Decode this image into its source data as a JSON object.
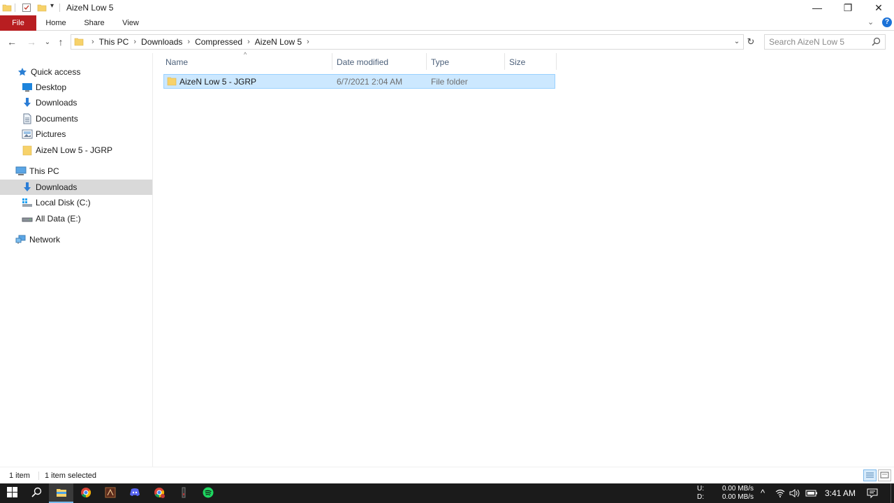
{
  "window": {
    "title": "AizeN Low 5",
    "controls": {
      "minimize": "—",
      "restore": "❐",
      "close": "✕"
    }
  },
  "ribbon": {
    "tabs": [
      "File",
      "Home",
      "Share",
      "View"
    ],
    "expand_glyph": "⌄",
    "help_glyph": "?"
  },
  "nav": {
    "back": "←",
    "forward": "→",
    "recent": "⌄",
    "up": "↑",
    "breadcrumbs": [
      "This PC",
      "Downloads",
      "Compressed",
      "AizeN Low 5"
    ],
    "separator": "›",
    "dropdown": "⌄",
    "refresh": "↻",
    "search_placeholder": "Search AizeN Low 5"
  },
  "sidebar": {
    "quick_access_label": "Quick access",
    "quick_items": [
      {
        "label": "Desktop",
        "icon": "desktop-icon",
        "pinned": true
      },
      {
        "label": "Downloads",
        "icon": "download-icon",
        "pinned": true
      },
      {
        "label": "Documents",
        "icon": "document-icon",
        "pinned": true
      },
      {
        "label": "Pictures",
        "icon": "pictures-icon",
        "pinned": true
      },
      {
        "label": "AizeN Low 5 - JGRP",
        "icon": "folder-icon",
        "pinned": true
      }
    ],
    "this_pc_label": "This PC",
    "pc_items": [
      {
        "label": "Downloads",
        "icon": "download-icon",
        "selected": true
      },
      {
        "label": "Local Disk (C:)",
        "icon": "windows-drive-icon"
      },
      {
        "label": "All Data (E:)",
        "icon": "drive-icon"
      }
    ],
    "network_label": "Network",
    "pin_glyph": "📌"
  },
  "list": {
    "columns": [
      "Name",
      "Date modified",
      "Type",
      "Size"
    ],
    "sort_glyph": "^",
    "rows": [
      {
        "name": "AizeN Low 5 - JGRP",
        "date": "6/7/2021 2:04 AM",
        "type": "File folder",
        "size": "",
        "selected": true
      }
    ]
  },
  "status": {
    "item_count": "1 item",
    "selected_count": "1 item selected"
  },
  "taskbar": {
    "net_upload_label": "U:",
    "net_download_label": "D:",
    "upload_speed": "0.00 MB/s",
    "download_speed": "0.00 MB/s",
    "tray_chevron": "^",
    "time": "3:41 AM",
    "apps": [
      "start-icon",
      "search-icon",
      "file-explorer-icon",
      "chrome-icon",
      "game-app-icon",
      "discord-icon",
      "chrome-alt-icon",
      "dark-app-icon",
      "spotify-icon"
    ]
  },
  "colors": {
    "file_tab": "#b81e21",
    "selection": "#cce8ff",
    "selection_border": "#99d1ff",
    "folder": "#f7d26a",
    "accent_blue": "#1b72d8",
    "taskbar": "#1b1b1b",
    "spotify": "#1ed760",
    "discord": "#5865f2"
  }
}
